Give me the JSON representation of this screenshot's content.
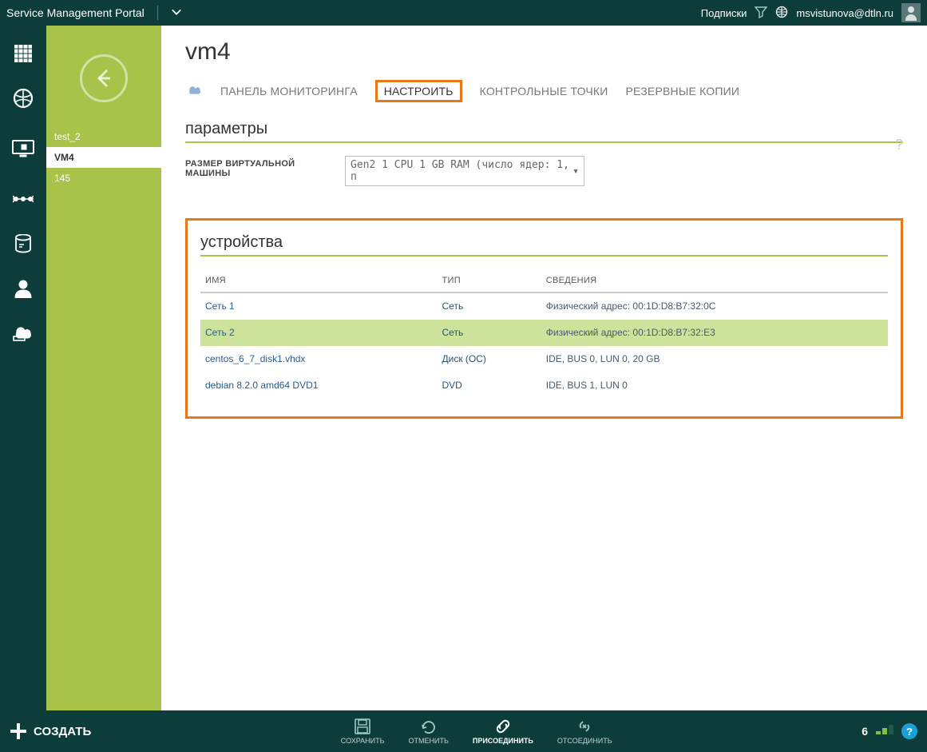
{
  "header": {
    "title": "Service Management Portal",
    "subscriptions": "Подписки",
    "user": "msvistunova@dtln.ru"
  },
  "sidebar": {
    "items": [
      {
        "label": "test_2"
      },
      {
        "label": "VM4"
      },
      {
        "label": "145"
      }
    ]
  },
  "page": {
    "title": "vm4",
    "tabs": [
      {
        "label": "ПАНЕЛЬ МОНИТОРИНГА"
      },
      {
        "label": "НАСТРОИТЬ"
      },
      {
        "label": "КОНТРОЛЬНЫЕ ТОЧКИ"
      },
      {
        "label": "РЕЗЕРВНЫЕ КОПИИ"
      }
    ],
    "section_params": "параметры",
    "vm_size_label": "РАЗМЕР ВИРТУАЛЬНОЙ МАШИНЫ",
    "vm_size_value": "Gen2 1 CPU 1 GB RAM (число ядер: 1, п",
    "section_devices": "устройства",
    "table": {
      "headers": {
        "name": "ИМЯ",
        "type": "ТИП",
        "details": "СВЕДЕНИЯ"
      },
      "rows": [
        {
          "name": "Сеть 1",
          "type": "Сеть",
          "details": "Физический адрес: 00:1D:D8:B7:32:0C"
        },
        {
          "name": "Сеть 2",
          "type": "Сеть",
          "details": "Физический адрес: 00:1D:D8:B7:32:E3"
        },
        {
          "name": "centos_6_7_disk1.vhdx",
          "type": "Диск (ОС)",
          "details": "IDE, BUS 0, LUN 0, 20 GB"
        },
        {
          "name": "debian 8.2.0 amd64 DVD1",
          "type": "DVD",
          "details": "IDE, BUS 1, LUN 0"
        }
      ]
    }
  },
  "bottombar": {
    "create": "СОЗДАТЬ",
    "save": "СОХРАНИТЬ",
    "cancel": "ОТМЕНИТЬ",
    "attach": "ПРИСОЕДИНИТЬ",
    "detach": "ОТСОЕДИНИТЬ",
    "count": "6"
  }
}
